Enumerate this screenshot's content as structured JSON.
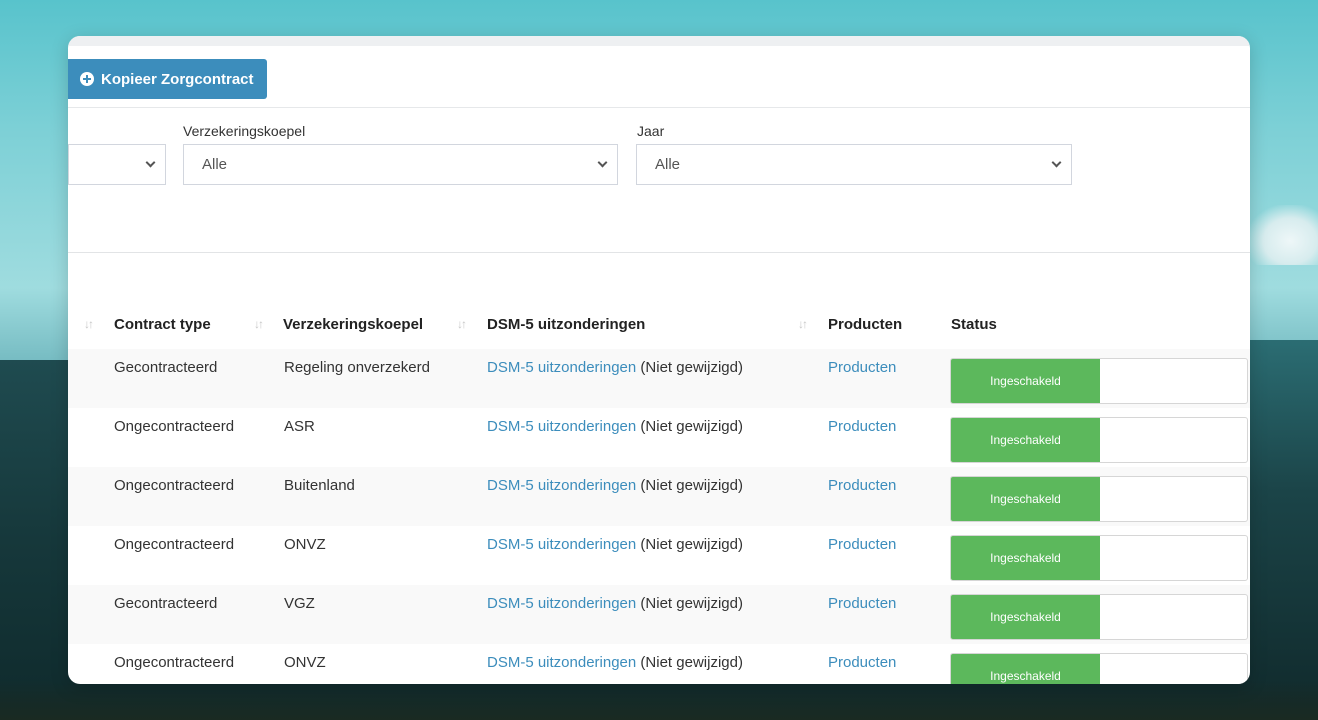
{
  "toolbar": {
    "copy_button_label": "Kopieer Zorgcontract"
  },
  "filters": [
    {
      "label": "",
      "value": ""
    },
    {
      "label": "Verzekeringskoepel",
      "value": "Alle"
    },
    {
      "label": "Jaar",
      "value": "Alle"
    }
  ],
  "table": {
    "headers": [
      "Contract type",
      "Verzekeringskoepel",
      "DSM-5 uitzonderingen",
      "Producten",
      "Status"
    ],
    "rows": [
      {
        "contract_type": "Gecontracteerd",
        "koepel": "Regeling onverzekerd",
        "dsm_link": "DSM-5 uitzonderingen",
        "dsm_note": "(Niet gewijzigd)",
        "products": "Producten",
        "status": "Ingeschakeld"
      },
      {
        "contract_type": "Ongecontracteerd",
        "koepel": "ASR",
        "dsm_link": "DSM-5 uitzonderingen",
        "dsm_note": "(Niet gewijzigd)",
        "products": "Producten",
        "status": "Ingeschakeld"
      },
      {
        "contract_type": "Ongecontracteerd",
        "koepel": "Buitenland",
        "dsm_link": "DSM-5 uitzonderingen",
        "dsm_note": "(Niet gewijzigd)",
        "products": "Producten",
        "status": "Ingeschakeld"
      },
      {
        "contract_type": "Ongecontracteerd",
        "koepel": "ONVZ",
        "dsm_link": "DSM-5 uitzonderingen",
        "dsm_note": "(Niet gewijzigd)",
        "products": "Producten",
        "status": "Ingeschakeld"
      },
      {
        "contract_type": "Gecontracteerd",
        "koepel": "VGZ",
        "dsm_link": "DSM-5 uitzonderingen",
        "dsm_note": "(Niet gewijzigd)",
        "products": "Producten",
        "status": "Ingeschakeld"
      },
      {
        "contract_type": "Ongecontracteerd",
        "koepel": "ONVZ",
        "dsm_link": "DSM-5 uitzonderingen",
        "dsm_note": "(Niet gewijzigd)",
        "products": "Producten",
        "status": "Ingeschakeld"
      }
    ]
  },
  "colors": {
    "primary": "#3c8dbc",
    "success": "#5cb85c"
  }
}
